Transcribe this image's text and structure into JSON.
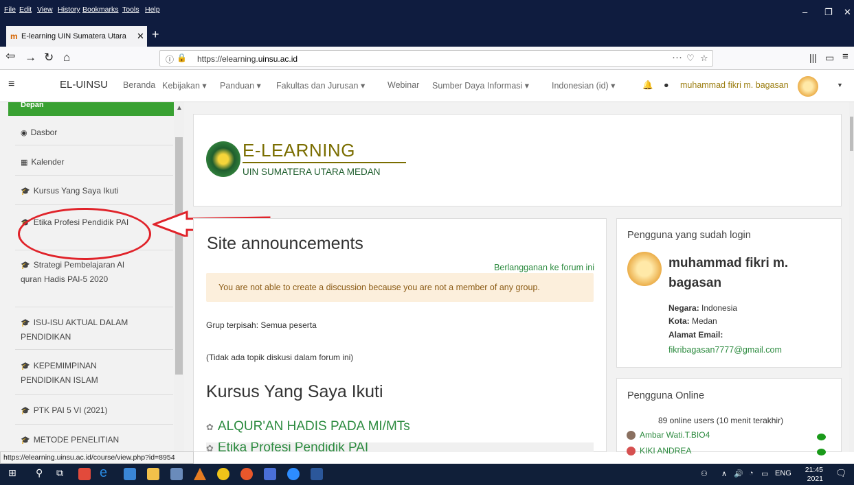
{
  "browser": {
    "menu": [
      "File",
      "Edit",
      "View",
      "History",
      "Bookmarks",
      "Tools",
      "Help"
    ],
    "tab_title": "E-learning UIN Sumatera Utara",
    "tab_close": "✕",
    "new_tab": "+",
    "url_prefix": "https://elearning.",
    "url_domain": "uinsu.ac.id",
    "more": "···"
  },
  "header": {
    "brand": "EL-UINSU",
    "nav": [
      "Beranda",
      "Kebijakan ▾",
      "Panduan ▾",
      "Fakultas dan Jurusan ▾",
      "Webinar",
      "Sumber Daya Informasi ▾",
      "Indonesian (id) ▾"
    ],
    "user": "muhammad fikri m. bagasan"
  },
  "sidebar": {
    "top_label": "Depan",
    "items": [
      {
        "icon": "dashboard-icon",
        "glyph": "◉",
        "label": "Dasbor"
      },
      {
        "icon": "calendar-icon",
        "glyph": "▦",
        "label": "Kalender"
      },
      {
        "icon": "graduation-cap-icon",
        "glyph": "🎓",
        "label": "Kursus Yang Saya Ikuti"
      },
      {
        "icon": "graduation-cap-icon",
        "glyph": "🎓",
        "label": "Etika Profesi Pendidik PAI"
      },
      {
        "icon": "graduation-cap-icon",
        "glyph": "🎓",
        "label": "Strategi Pembelajaran Al quran Hadis PAI-5 2020"
      },
      {
        "icon": "graduation-cap-icon",
        "glyph": "🎓",
        "label": "ISU-ISU AKTUAL DALAM PENDIDIKAN"
      },
      {
        "icon": "graduation-cap-icon",
        "glyph": "🎓",
        "label": "KEPEMIMPINAN PENDIDIKAN ISLAM"
      },
      {
        "icon": "graduation-cap-icon",
        "glyph": "🎓",
        "label": "PTK PAI 5 VI (2021)"
      },
      {
        "icon": "graduation-cap-icon",
        "glyph": "🎓",
        "label": "METODE PENELITIAN"
      }
    ]
  },
  "logo": {
    "title": "E-LEARNING",
    "subtitle": "UIN SUMATERA UTARA MEDAN"
  },
  "main": {
    "site_title": "Site announcements",
    "subscribe": "Berlangganan ke forum ini",
    "alert": "You are not able to create a discussion because you are not a member of any group.",
    "group": "Grup terpisah: Semua peserta",
    "no_topics": "(Tidak ada topik diskusi dalam forum ini)",
    "courses_title": "Kursus Yang Saya Ikuti",
    "courses": [
      "ALQUR'AN HADIS PADA MI/MTs",
      "Etika Profesi Pendidik PAI"
    ]
  },
  "login_block": {
    "title": "Pengguna yang sudah login",
    "name": "muhammad fikri m. bagasan",
    "country_label": "Negara:",
    "country": "Indonesia",
    "city_label": "Kota:",
    "city": "Medan",
    "email_label": "Alamat Email:",
    "email": "fikribagasan7777@gmail.com"
  },
  "online_block": {
    "title": "Pengguna Online",
    "count": "89 online users (10 menit terakhir)",
    "users": [
      "Ambar Wati.T.BIO4",
      "KIKI ANDREA"
    ]
  },
  "status_url": "https://elearning.uinsu.ac.id/course/view.php?id=8954",
  "taskbar": {
    "lang": "ENG",
    "time": "21:45",
    "year": "2021"
  },
  "colors": {
    "green": "#2b8a3e",
    "annotation": "#e0232a",
    "chrome": "#0f1c3f"
  }
}
